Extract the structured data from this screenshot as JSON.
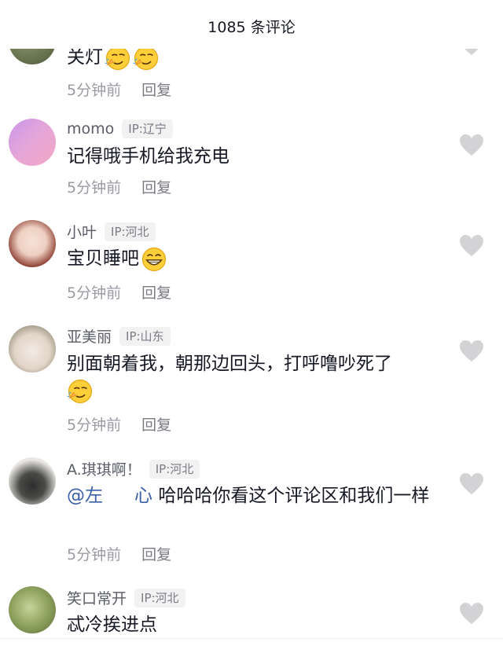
{
  "header": {
    "title": "1085 条评论"
  },
  "colors": {
    "heart": "#d3d3d6",
    "mention": "#3a5fa8",
    "meta": "#9a9ba2",
    "ip_badge_bg": "#f2f2f3"
  },
  "comments": [
    {
      "username": "",
      "ip": "",
      "text": "关灯",
      "time": "5分钟前",
      "reply": "回复",
      "emojis": [
        "smirk-emoji",
        "smirk-emoji"
      ]
    },
    {
      "username": "momo",
      "ip": "IP:辽宁",
      "text": "记得哦手机给我充电",
      "time": "5分钟前",
      "reply": "回复"
    },
    {
      "username": "小叶",
      "ip": "IP:河北",
      "text": "宝贝睡吧",
      "time": "5分钟前",
      "reply": "回复",
      "emojis": [
        "grin-emoji"
      ]
    },
    {
      "username": "亚美丽",
      "ip": "IP:山东",
      "text": "别面朝着我，朝那边回头，打呼噜吵死了",
      "time": "5分钟前",
      "reply": "回复",
      "emojis": [
        "smirk-emoji"
      ]
    },
    {
      "username": "A.琪琪啊！",
      "ip": "IP:河北",
      "mention": "@左",
      "mention_tail": "心",
      "text": "哈哈哈你看这个评论区和我们一样",
      "time": "5分钟前",
      "reply": "回复"
    },
    {
      "username": "笑口常开",
      "ip": "IP:河北",
      "text": "忒冷挨进点",
      "time": "",
      "reply": ""
    }
  ]
}
